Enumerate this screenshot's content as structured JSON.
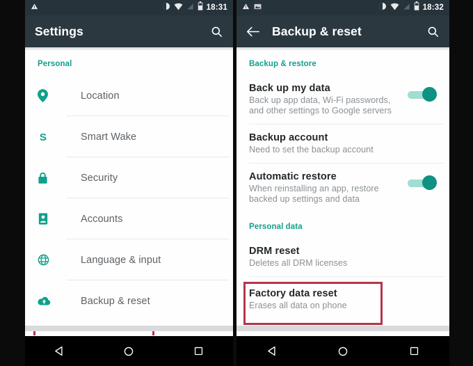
{
  "theme": {
    "accent_teal": "#12a08a",
    "appbar_bg": "#2b3840",
    "statusbar_bg": "#27333b",
    "highlight_red": "#b5354a",
    "navbar_bg": "#000000"
  },
  "left_phone": {
    "statusbar": {
      "time": "18:31",
      "icons": [
        "warning-icon",
        "dnd-icon",
        "wifi-icon",
        "signal-icon",
        "battery-icon"
      ]
    },
    "appbar": {
      "title": "Settings",
      "search_icon": "search-icon"
    },
    "section_label": "Personal",
    "items": [
      {
        "label": "Location",
        "icon": "location-pin-icon"
      },
      {
        "label": "Smart Wake",
        "icon": "smart-wake-s-icon"
      },
      {
        "label": "Security",
        "icon": "lock-icon"
      },
      {
        "label": "Accounts",
        "icon": "account-badge-icon"
      },
      {
        "label": "Language & input",
        "icon": "globe-icon"
      },
      {
        "label": "Backup & reset",
        "icon": "cloud-upload-icon"
      }
    ],
    "highlighted_item": "Backup & reset",
    "navbar": {
      "back": "back-triangle-icon",
      "home": "home-circle-icon",
      "recents": "recents-square-icon"
    }
  },
  "right_phone": {
    "statusbar": {
      "time": "18:32",
      "icons": [
        "warning-icon",
        "screenshot-icon",
        "dnd-icon",
        "wifi-icon",
        "signal-icon",
        "battery-icon"
      ]
    },
    "appbar": {
      "back_icon": "back-arrow-icon",
      "title": "Backup & reset",
      "search_icon": "search-icon"
    },
    "sections": [
      {
        "label": "Backup & restore",
        "items": [
          {
            "title": "Back up my data",
            "subtitle": "Back up app data, Wi-Fi passwords, and other settings to Google servers",
            "toggle": "on"
          },
          {
            "title": "Backup account",
            "subtitle": "Need to set the backup account",
            "toggle": null
          },
          {
            "title": "Automatic restore",
            "subtitle": "When reinstalling an app, restore backed up settings and data",
            "toggle": "on"
          }
        ]
      },
      {
        "label": "Personal data",
        "items": [
          {
            "title": "DRM reset",
            "subtitle": "Deletes all DRM licenses",
            "toggle": null
          },
          {
            "title": "Factory data reset",
            "subtitle": "Erases all data on phone",
            "toggle": null
          }
        ]
      }
    ],
    "highlighted_item": "Factory data reset",
    "navbar": {
      "back": "back-triangle-icon",
      "home": "home-circle-icon",
      "recents": "recents-square-icon"
    }
  }
}
